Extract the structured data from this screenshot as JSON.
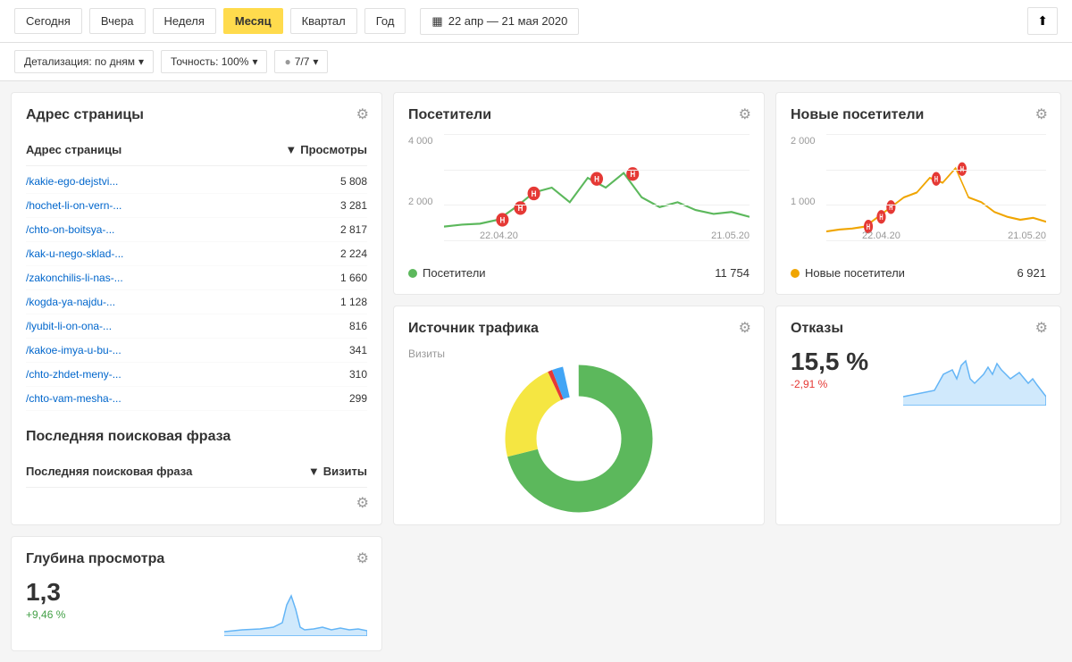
{
  "topBar": {
    "periods": [
      "Сегодня",
      "Вчера",
      "Неделя",
      "Месяц",
      "Квартал",
      "Год"
    ],
    "activePeriod": "Месяц",
    "dateRange": "22 апр — 21 мая 2020",
    "calendarIcon": "▦"
  },
  "filterBar": {
    "detalization": "Детализация: по дням",
    "accuracy": "Точность: 100%",
    "segments": "7/7"
  },
  "visitors": {
    "title": "Посетители",
    "yLabels": [
      "4 000",
      "2 000"
    ],
    "xLabels": [
      "22.04.20",
      "21.05.20"
    ],
    "legendLabel": "Посетители",
    "legendColor": "#5cb85c",
    "count": "11 754"
  },
  "newVisitors": {
    "title": "Новые посетители",
    "yLabels": [
      "2 000",
      "1 000"
    ],
    "xLabels": [
      "22.04.20",
      "21.05.20"
    ],
    "legendLabel": "Новые посетители",
    "legendColor": "#f0a500",
    "count": "6 921"
  },
  "addressPage": {
    "title": "Адрес страницы",
    "colAddress": "Адрес страницы",
    "colViews": "Просмотры",
    "rows": [
      {
        "url": "/kakie-ego-dejstvi...",
        "views": "5 808"
      },
      {
        "url": "/hochet-li-on-vern-...",
        "views": "3 281"
      },
      {
        "url": "/chto-on-boitsya-...",
        "views": "2 817"
      },
      {
        "url": "/kak-u-nego-sklad-...",
        "views": "2 224"
      },
      {
        "url": "/zakonchilis-li-nas-...",
        "views": "1 660"
      },
      {
        "url": "/kogda-ya-najdu-...",
        "views": "1 128"
      },
      {
        "url": "/lyubit-li-on-ona-...",
        "views": "816"
      },
      {
        "url": "/kakoe-imya-u-bu-...",
        "views": "341"
      },
      {
        "url": "/chto-zhdet-meny-...",
        "views": "310"
      },
      {
        "url": "/chto-vam-mesha-...",
        "views": "299"
      }
    ]
  },
  "trafficSource": {
    "title": "Источник трафика",
    "subtitle": "Визиты"
  },
  "bounceRate": {
    "title": "Отказы",
    "value": "15,5 %",
    "delta": "-2,91 %",
    "deltaType": "negative"
  },
  "viewDepth": {
    "title": "Глубина просмотра",
    "value": "1,3",
    "delta": "+9,46 %",
    "deltaType": "positive"
  },
  "lastSearch": {
    "title": "Последняя поисковая фраза",
    "colPhrase": "Последняя поисковая фраза",
    "colVisits": "Визиты"
  },
  "gearIcon": "⚙",
  "exportIcon": "↑",
  "segmentIcon": "●"
}
